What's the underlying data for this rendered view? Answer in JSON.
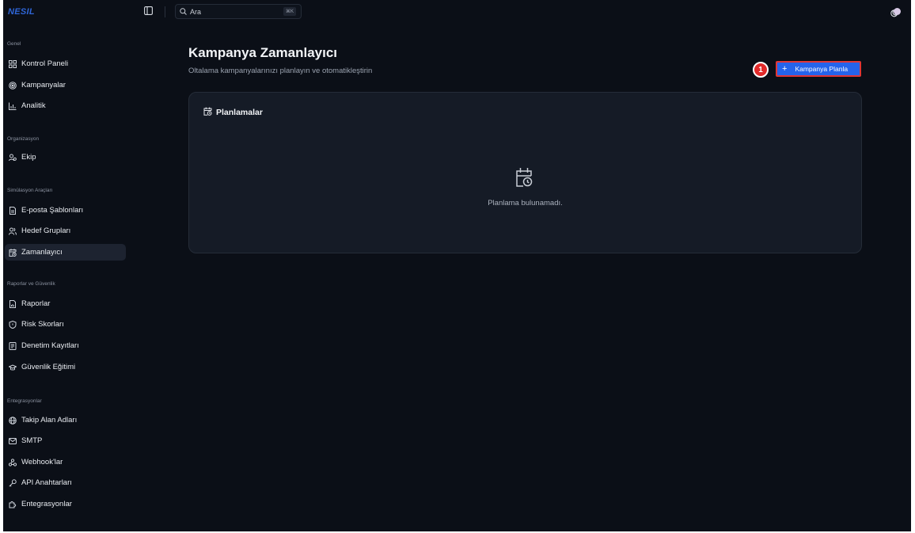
{
  "brand": {
    "logo_text": "NESIL",
    "accent_color": "#2f66d8"
  },
  "topbar": {
    "search_placeholder": "Ara",
    "search_shortcut": "⌘K",
    "sidebar_toggle_icon": "sidebar-toggle-icon",
    "theme_icon": "moon-icon",
    "avatar_color": "#d7c9e6"
  },
  "sidebar": {
    "groups": [
      {
        "label": "Genel"
      },
      {
        "label": "Organizasyon"
      },
      {
        "label": "Simülasyon Araçları"
      },
      {
        "label": "Raporlar ve Güvenlik"
      },
      {
        "label": "Entegrasyonlar"
      }
    ],
    "items": [
      {
        "label": "Kontrol Paneli",
        "icon": "dashboard-icon"
      },
      {
        "label": "Kampanyalar",
        "icon": "target-icon"
      },
      {
        "label": "Analitik",
        "icon": "bar-chart-icon"
      },
      {
        "label": "Ekip",
        "icon": "team-icon"
      },
      {
        "label": "E-posta Şablonları",
        "icon": "file-text-icon"
      },
      {
        "label": "Hedef Grupları",
        "icon": "users-icon"
      },
      {
        "label": "Zamanlayıcı",
        "icon": "calendar-clock-icon",
        "active": true
      },
      {
        "label": "Raporlar",
        "icon": "report-icon"
      },
      {
        "label": "Risk Skorları",
        "icon": "shield-icon"
      },
      {
        "label": "Denetim Kayıtları",
        "icon": "audit-log-icon"
      },
      {
        "label": "Güvenlik Eğitimi",
        "icon": "graduation-cap-icon"
      },
      {
        "label": "Takip Alan Adları",
        "icon": "globe-icon"
      },
      {
        "label": "SMTP",
        "icon": "mail-icon"
      },
      {
        "label": "Webhook'lar",
        "icon": "webhook-icon"
      },
      {
        "label": "API Anahtarları",
        "icon": "key-icon"
      },
      {
        "label": "Entegrasyonlar",
        "icon": "puzzle-icon"
      }
    ]
  },
  "main": {
    "title": "Kampanya Zamanlayıcı",
    "subtitle": "Oltalama kampanyalarınızı planlayın ve otomatikleştirin",
    "primary_button_label": "Kampanya Planla",
    "step_badge": "1",
    "card": {
      "title": "Planlamalar",
      "empty_text": "Planlama bulunamadı."
    }
  },
  "colors": {
    "background": "#0b0f17",
    "card_bg": "#151b26",
    "primary": "#2563eb",
    "highlight": "#e03636"
  }
}
